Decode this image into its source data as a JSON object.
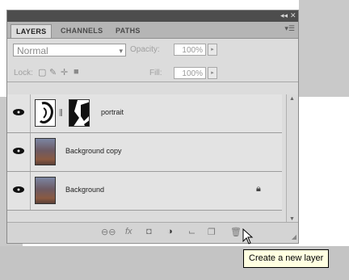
{
  "panel": {
    "tabs": [
      "LAYERS",
      "CHANNELS",
      "PATHS"
    ],
    "blend_mode": "Normal",
    "opacity_label": "Opacity:",
    "opacity_value": "100%",
    "lock_label": "Lock:",
    "fill_label": "Fill:",
    "fill_value": "100%"
  },
  "layers": [
    {
      "name": "portrait",
      "has_mask": true,
      "visible": true
    },
    {
      "name": "Background copy",
      "visible": true
    },
    {
      "name": "Background",
      "visible": true,
      "locked": true
    }
  ],
  "bottom_icons": [
    "link-layers-icon",
    "add-layer-style-icon",
    "add-layer-mask-icon",
    "adjustment-layer-icon",
    "new-group-icon",
    "new-layer-icon",
    "trash-icon"
  ],
  "tooltip": "Create a new layer"
}
